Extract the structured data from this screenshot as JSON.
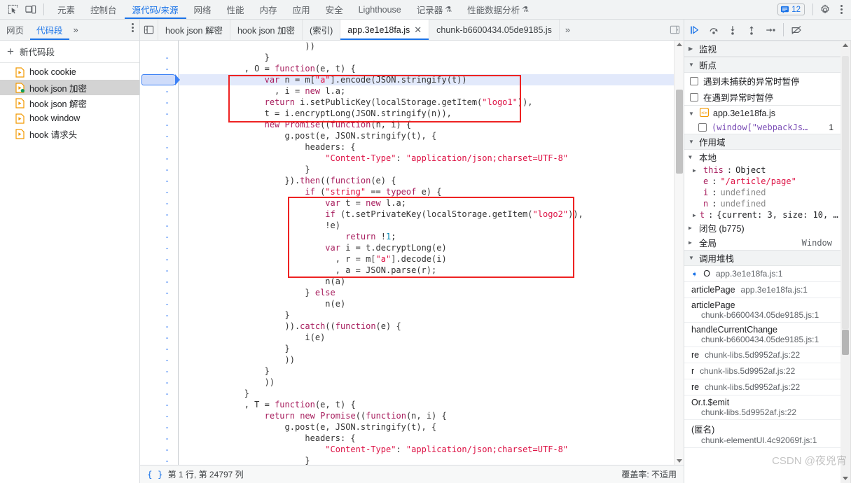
{
  "toolbar": {
    "icons": [
      {
        "name": "inspect-element-icon",
        "title": "检查"
      },
      {
        "name": "device-toolbar-icon",
        "title": "设备工具栏"
      }
    ],
    "tabs": [
      {
        "label": "元素",
        "active": false,
        "flask": false
      },
      {
        "label": "控制台",
        "active": false,
        "flask": false
      },
      {
        "label": "源代码/来源",
        "active": true,
        "flask": false
      },
      {
        "label": "网络",
        "active": false,
        "flask": false
      },
      {
        "label": "性能",
        "active": false,
        "flask": false
      },
      {
        "label": "内存",
        "active": false,
        "flask": false
      },
      {
        "label": "应用",
        "active": false,
        "flask": false
      },
      {
        "label": "安全",
        "active": false,
        "flask": false
      },
      {
        "label": "Lighthouse",
        "active": false,
        "flask": false
      },
      {
        "label": "记录器",
        "active": false,
        "flask": true
      },
      {
        "label": "性能数据分析",
        "active": false,
        "flask": true
      }
    ],
    "message_count": "12",
    "settings_label": "设置",
    "kebab_label": "自定义及控制开发者工具"
  },
  "nav": {
    "tabs": [
      {
        "label": "网页",
        "active": false
      },
      {
        "label": "代码段",
        "active": true
      }
    ],
    "more": "»",
    "kebab_label": "更多选项"
  },
  "editor_tabs": {
    "show_navigator_label": "显示导航栏",
    "tabs": [
      {
        "label": "hook json 解密",
        "active": false,
        "closable": false
      },
      {
        "label": "hook json 加密",
        "active": false,
        "closable": false
      },
      {
        "label": "(索引)",
        "active": false,
        "closable": false
      },
      {
        "label": "app.3e1e18fa.js",
        "active": true,
        "closable": true
      },
      {
        "label": "chunk-b6600434.05de9185.js",
        "active": false,
        "closable": false
      }
    ],
    "more": "»",
    "show_debugger_label": "显示调试程序"
  },
  "debugger_toolbar": {
    "buttons": [
      {
        "name": "resume-script-button",
        "label": "继续执行脚本"
      },
      {
        "name": "step-over-button",
        "label": "跳过下一个函数调用"
      },
      {
        "name": "step-into-button",
        "label": "单步调试下一个函数调用"
      },
      {
        "name": "step-out-button",
        "label": "跳出当前函数"
      },
      {
        "name": "step-button",
        "label": "步进"
      },
      {
        "name": "deactivate-breakpoints-button",
        "label": "停用断点"
      }
    ]
  },
  "sidebar": {
    "new_snippet": "新代码段",
    "snippets": [
      {
        "label": "hook cookie",
        "selected": false,
        "running": false
      },
      {
        "label": "hook json 加密",
        "selected": true,
        "running": true
      },
      {
        "label": "hook json 解密",
        "selected": false,
        "running": false
      },
      {
        "label": "hook window",
        "selected": false,
        "running": false
      },
      {
        "label": "hook 请求头",
        "selected": false,
        "running": false
      }
    ]
  },
  "editor": {
    "lines": [
      {
        "n": "",
        "gutter": "",
        "exec": false,
        "tokens": [
          {
            "t": "                        ))",
            "c": "pl"
          }
        ]
      },
      {
        "n": "",
        "gutter": "-",
        "exec": false,
        "tokens": [
          {
            "t": "                }",
            "c": "pl"
          }
        ]
      },
      {
        "n": "",
        "gutter": "-",
        "exec": false,
        "tokens": [
          {
            "t": "            , ",
            "c": "pl"
          },
          {
            "t": "O",
            "c": "pl"
          },
          {
            "t": " = ",
            "c": "pl"
          },
          {
            "t": "function",
            "c": "kw"
          },
          {
            "t": "(e, t) {",
            "c": "pl"
          }
        ]
      },
      {
        "n": "",
        "gutter": "-",
        "exec": true,
        "tokens": [
          {
            "t": "                ",
            "c": "pl"
          },
          {
            "t": "var",
            "c": "kw"
          },
          {
            "t": " n = m[",
            "c": "pl"
          },
          {
            "t": "\"a\"",
            "c": "str"
          },
          {
            "t": "].encode(JSON.stringify(t))",
            "c": "pl"
          }
        ]
      },
      {
        "n": "",
        "gutter": "-",
        "exec": false,
        "tokens": [
          {
            "t": "                  , i = ",
            "c": "pl"
          },
          {
            "t": "new",
            "c": "kw"
          },
          {
            "t": " l.a;",
            "c": "pl"
          }
        ]
      },
      {
        "n": "",
        "gutter": "-",
        "exec": false,
        "tokens": [
          {
            "t": "                ",
            "c": "pl"
          },
          {
            "t": "return",
            "c": "kw"
          },
          {
            "t": " i.setPublicKey(localStorage.getItem(",
            "c": "pl"
          },
          {
            "t": "\"logo1\"",
            "c": "str"
          },
          {
            "t": ")),",
            "c": "pl"
          }
        ]
      },
      {
        "n": "",
        "gutter": "-",
        "exec": false,
        "tokens": [
          {
            "t": "                t = i.encryptLong(JSON.stringify(n)),",
            "c": "pl"
          }
        ]
      },
      {
        "n": "",
        "gutter": "-",
        "exec": false,
        "tokens": [
          {
            "t": "                ",
            "c": "pl"
          },
          {
            "t": "new",
            "c": "kw"
          },
          {
            "t": " ",
            "c": "pl"
          },
          {
            "t": "Promise",
            "c": "fn"
          },
          {
            "t": "((",
            "c": "pl"
          },
          {
            "t": "function",
            "c": "kw"
          },
          {
            "t": "(n, i) {",
            "c": "pl"
          }
        ]
      },
      {
        "n": "",
        "gutter": "-",
        "exec": false,
        "tokens": [
          {
            "t": "                    g.post(e, JSON.stringify(t), {",
            "c": "pl"
          }
        ]
      },
      {
        "n": "",
        "gutter": "-",
        "exec": false,
        "tokens": [
          {
            "t": "                        headers: {",
            "c": "pl"
          }
        ]
      },
      {
        "n": "",
        "gutter": "-",
        "exec": false,
        "tokens": [
          {
            "t": "                            ",
            "c": "pl"
          },
          {
            "t": "\"Content-Type\"",
            "c": "str"
          },
          {
            "t": ": ",
            "c": "pl"
          },
          {
            "t": "\"application/json;charset=UTF-8\"",
            "c": "str"
          }
        ]
      },
      {
        "n": "",
        "gutter": "-",
        "exec": false,
        "tokens": [
          {
            "t": "                        }",
            "c": "pl"
          }
        ]
      },
      {
        "n": "",
        "gutter": "-",
        "exec": false,
        "tokens": [
          {
            "t": "                    }).",
            "c": "pl"
          },
          {
            "t": "then",
            "c": "fn"
          },
          {
            "t": "((",
            "c": "pl"
          },
          {
            "t": "function",
            "c": "kw"
          },
          {
            "t": "(e) {",
            "c": "pl"
          }
        ]
      },
      {
        "n": "",
        "gutter": "-",
        "exec": false,
        "tokens": [
          {
            "t": "                        ",
            "c": "pl"
          },
          {
            "t": "if",
            "c": "kw"
          },
          {
            "t": " (",
            "c": "pl"
          },
          {
            "t": "\"string\"",
            "c": "str"
          },
          {
            "t": " == ",
            "c": "pl"
          },
          {
            "t": "typeof",
            "c": "kw"
          },
          {
            "t": " e) {",
            "c": "pl"
          }
        ]
      },
      {
        "n": "",
        "gutter": "-",
        "exec": false,
        "tokens": [
          {
            "t": "                            ",
            "c": "pl"
          },
          {
            "t": "var",
            "c": "kw"
          },
          {
            "t": " t = ",
            "c": "pl"
          },
          {
            "t": "new",
            "c": "kw"
          },
          {
            "t": " l.a;",
            "c": "pl"
          }
        ]
      },
      {
        "n": "",
        "gutter": "-",
        "exec": false,
        "tokens": [
          {
            "t": "                            ",
            "c": "pl"
          },
          {
            "t": "if",
            "c": "kw"
          },
          {
            "t": " (t.setPrivateKey(localStorage.getItem(",
            "c": "pl"
          },
          {
            "t": "\"logo2\"",
            "c": "str"
          },
          {
            "t": ")),",
            "c": "pl"
          }
        ]
      },
      {
        "n": "",
        "gutter": "-",
        "exec": false,
        "tokens": [
          {
            "t": "                            !e)",
            "c": "pl"
          }
        ]
      },
      {
        "n": "",
        "gutter": "-",
        "exec": false,
        "tokens": [
          {
            "t": "                                ",
            "c": "pl"
          },
          {
            "t": "return",
            "c": "kw"
          },
          {
            "t": " !",
            "c": "pl"
          },
          {
            "t": "1",
            "c": "num"
          },
          {
            "t": ";",
            "c": "pl"
          }
        ]
      },
      {
        "n": "",
        "gutter": "-",
        "exec": false,
        "tokens": [
          {
            "t": "                            ",
            "c": "pl"
          },
          {
            "t": "var",
            "c": "kw"
          },
          {
            "t": " i = t.decryptLong(e)",
            "c": "pl"
          }
        ]
      },
      {
        "n": "",
        "gutter": "-",
        "exec": false,
        "tokens": [
          {
            "t": "                              , r = m[",
            "c": "pl"
          },
          {
            "t": "\"a\"",
            "c": "str"
          },
          {
            "t": "].decode(i)",
            "c": "pl"
          }
        ]
      },
      {
        "n": "",
        "gutter": "-",
        "exec": false,
        "tokens": [
          {
            "t": "                              , a = JSON.parse(r);",
            "c": "pl"
          }
        ]
      },
      {
        "n": "",
        "gutter": "-",
        "exec": false,
        "tokens": [
          {
            "t": "                            n(a)",
            "c": "pl"
          }
        ]
      },
      {
        "n": "",
        "gutter": "-",
        "exec": false,
        "tokens": [
          {
            "t": "                        } ",
            "c": "pl"
          },
          {
            "t": "else",
            "c": "kw"
          }
        ]
      },
      {
        "n": "",
        "gutter": "-",
        "exec": false,
        "tokens": [
          {
            "t": "                            n(e)",
            "c": "pl"
          }
        ]
      },
      {
        "n": "",
        "gutter": "-",
        "exec": false,
        "tokens": [
          {
            "t": "                    }",
            "c": "pl"
          }
        ]
      },
      {
        "n": "",
        "gutter": "-",
        "exec": false,
        "tokens": [
          {
            "t": "                    )).",
            "c": "pl"
          },
          {
            "t": "catch",
            "c": "fn"
          },
          {
            "t": "((",
            "c": "pl"
          },
          {
            "t": "function",
            "c": "kw"
          },
          {
            "t": "(e) {",
            "c": "pl"
          }
        ]
      },
      {
        "n": "",
        "gutter": "-",
        "exec": false,
        "tokens": [
          {
            "t": "                        i(e)",
            "c": "pl"
          }
        ]
      },
      {
        "n": "",
        "gutter": "-",
        "exec": false,
        "tokens": [
          {
            "t": "                    }",
            "c": "pl"
          }
        ]
      },
      {
        "n": "",
        "gutter": "-",
        "exec": false,
        "tokens": [
          {
            "t": "                    ))",
            "c": "pl"
          }
        ]
      },
      {
        "n": "",
        "gutter": "-",
        "exec": false,
        "tokens": [
          {
            "t": "                }",
            "c": "pl"
          }
        ]
      },
      {
        "n": "",
        "gutter": "-",
        "exec": false,
        "tokens": [
          {
            "t": "                ))",
            "c": "pl"
          }
        ]
      },
      {
        "n": "",
        "gutter": "-",
        "exec": false,
        "tokens": [
          {
            "t": "            }",
            "c": "pl"
          }
        ]
      },
      {
        "n": "",
        "gutter": "-",
        "exec": false,
        "tokens": [
          {
            "t": "            , ",
            "c": "pl"
          },
          {
            "t": "T",
            "c": "pl"
          },
          {
            "t": " = ",
            "c": "pl"
          },
          {
            "t": "function",
            "c": "kw"
          },
          {
            "t": "(e, t) {",
            "c": "pl"
          }
        ]
      },
      {
        "n": "",
        "gutter": "-",
        "exec": false,
        "tokens": [
          {
            "t": "                ",
            "c": "pl"
          },
          {
            "t": "return",
            "c": "kw"
          },
          {
            "t": " ",
            "c": "pl"
          },
          {
            "t": "new",
            "c": "kw"
          },
          {
            "t": " ",
            "c": "pl"
          },
          {
            "t": "Promise",
            "c": "fn"
          },
          {
            "t": "((",
            "c": "pl"
          },
          {
            "t": "function",
            "c": "kw"
          },
          {
            "t": "(n, i) {",
            "c": "pl"
          }
        ]
      },
      {
        "n": "",
        "gutter": "-",
        "exec": false,
        "tokens": [
          {
            "t": "                    g.post(e, JSON.stringify(t), {",
            "c": "pl"
          }
        ]
      },
      {
        "n": "",
        "gutter": "-",
        "exec": false,
        "tokens": [
          {
            "t": "                        headers: {",
            "c": "pl"
          }
        ]
      },
      {
        "n": "",
        "gutter": "-",
        "exec": false,
        "tokens": [
          {
            "t": "                            ",
            "c": "pl"
          },
          {
            "t": "\"Content-Type\"",
            "c": "str"
          },
          {
            "t": ": ",
            "c": "pl"
          },
          {
            "t": "\"application/json;charset=UTF-8\"",
            "c": "str"
          }
        ]
      },
      {
        "n": "",
        "gutter": "-",
        "exec": false,
        "tokens": [
          {
            "t": "                        }",
            "c": "pl"
          }
        ]
      },
      {
        "n": "",
        "gutter": "-",
        "exec": false,
        "tokens": [
          {
            "t": "                    }).",
            "c": "pl"
          },
          {
            "t": "then",
            "c": "fn"
          },
          {
            "t": "((",
            "c": "pl"
          },
          {
            "t": "function",
            "c": "kw"
          },
          {
            "t": "(e) {",
            "c": "pl"
          }
        ]
      }
    ]
  },
  "status": {
    "cursor": "第 1 行, 第 24797 列",
    "coverage": "覆盖率: 不适用"
  },
  "debugger": {
    "watch": {
      "title": "监视",
      "expanded": false
    },
    "breakpoints": {
      "title": "断点",
      "options": [
        {
          "label": "遇到未捕获的异常时暂停",
          "checked": false
        },
        {
          "label": "在遇到异常时暂停",
          "checked": false
        }
      ],
      "file": "app.3e1e18fa.js",
      "items": [
        {
          "label": "(window[\"webpackJs…",
          "lineno": "1",
          "checked": false
        }
      ]
    },
    "scope": {
      "title": "作用域",
      "local_title": "本地",
      "vars": [
        {
          "name": "this",
          "value": "Object",
          "expandable": true,
          "kind": "obj"
        },
        {
          "name": "e",
          "value": "\"/article/page\"",
          "expandable": false,
          "kind": "str"
        },
        {
          "name": "i",
          "value": "undefined",
          "expandable": false,
          "kind": "undef"
        },
        {
          "name": "n",
          "value": "undefined",
          "expandable": false,
          "kind": "undef"
        },
        {
          "name": "t",
          "value": "{current: 3, size: 10, …",
          "expandable": true,
          "kind": "obj"
        }
      ],
      "closure": {
        "label": "闭包 (b775)"
      },
      "global": {
        "label": "全局",
        "value": "Window"
      }
    },
    "callstack": {
      "title": "调用堆栈",
      "frames": [
        {
          "name": "O",
          "location": "app.3e1e18fa.js:1",
          "selected": true,
          "wrap": false
        },
        {
          "name": "articlePage",
          "location": "app.3e1e18fa.js:1",
          "selected": false,
          "wrap": false
        },
        {
          "name": "articlePage",
          "location": "chunk-b6600434.05de9185.js:1",
          "selected": false,
          "wrap": true
        },
        {
          "name": "handleCurrentChange",
          "location": "chunk-b6600434.05de9185.js:1",
          "selected": false,
          "wrap": true
        },
        {
          "name": "re",
          "location": "chunk-libs.5d9952af.js:22",
          "selected": false,
          "wrap": false
        },
        {
          "name": "r",
          "location": "chunk-libs.5d9952af.js:22",
          "selected": false,
          "wrap": false
        },
        {
          "name": "re",
          "location": "chunk-libs.5d9952af.js:22",
          "selected": false,
          "wrap": false
        },
        {
          "name": "Or.t.$emit",
          "location": "chunk-libs.5d9952af.js:22",
          "selected": false,
          "wrap": true
        },
        {
          "name": "(匿名)",
          "location": "chunk-elementUI.4c92069f.js:1",
          "selected": false,
          "wrap": true
        }
      ]
    }
  },
  "watermark": "CSDN @夜兇宵"
}
